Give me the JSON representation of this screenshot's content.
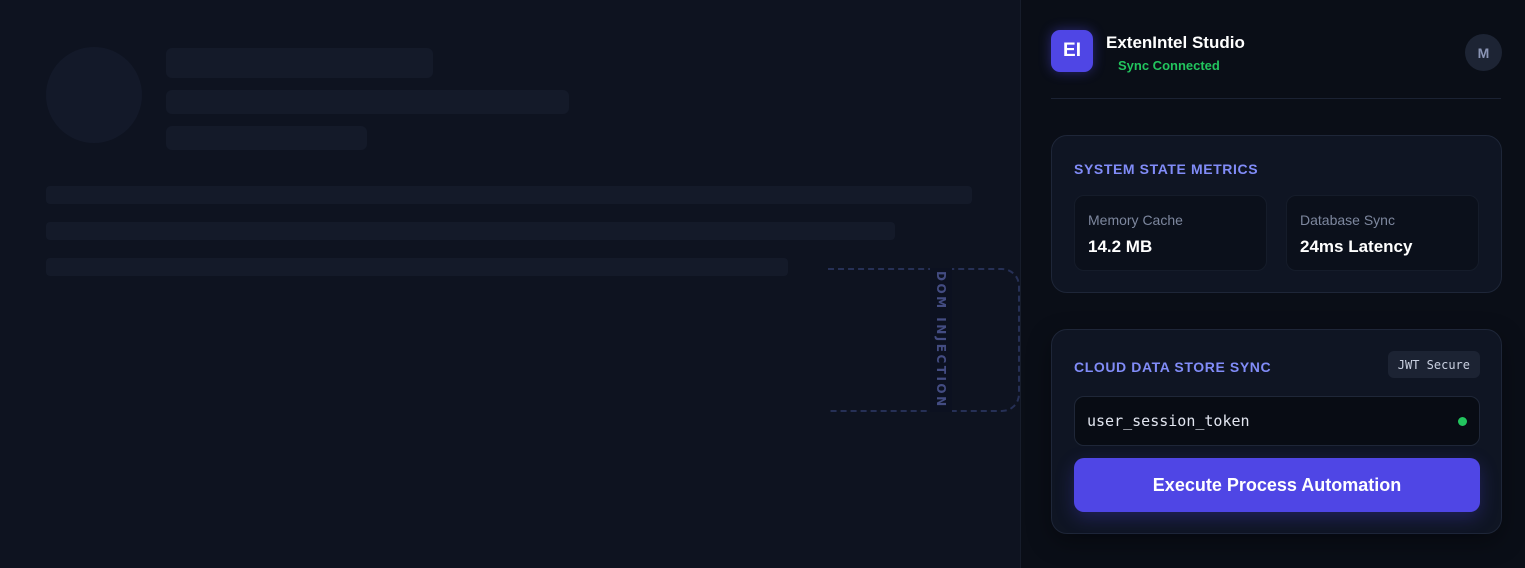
{
  "host_page": {
    "injection_label": "DOM INJECTION"
  },
  "extension": {
    "logo_text": "EI",
    "app_title": "ExtenIntel Studio",
    "sync_status": "Sync Connected",
    "user_initial": "M",
    "colors": {
      "accent": "#4f46e5",
      "accent_text": "#818cf8",
      "success": "#22c55e",
      "panel_bg": "#0a0e17"
    },
    "metrics_card": {
      "title": "SYSTEM STATE METRICS",
      "metrics": [
        {
          "label": "Memory Cache",
          "value": "14.2 MB"
        },
        {
          "label": "Database Sync",
          "value": "24ms Latency"
        }
      ]
    },
    "sync_card": {
      "title": "CLOUD DATA STORE SYNC",
      "badge": "JWT Secure",
      "token_input_value": "user_session_token",
      "status_icon": "green-dot-icon",
      "button_label": "Execute Process Automation"
    }
  }
}
